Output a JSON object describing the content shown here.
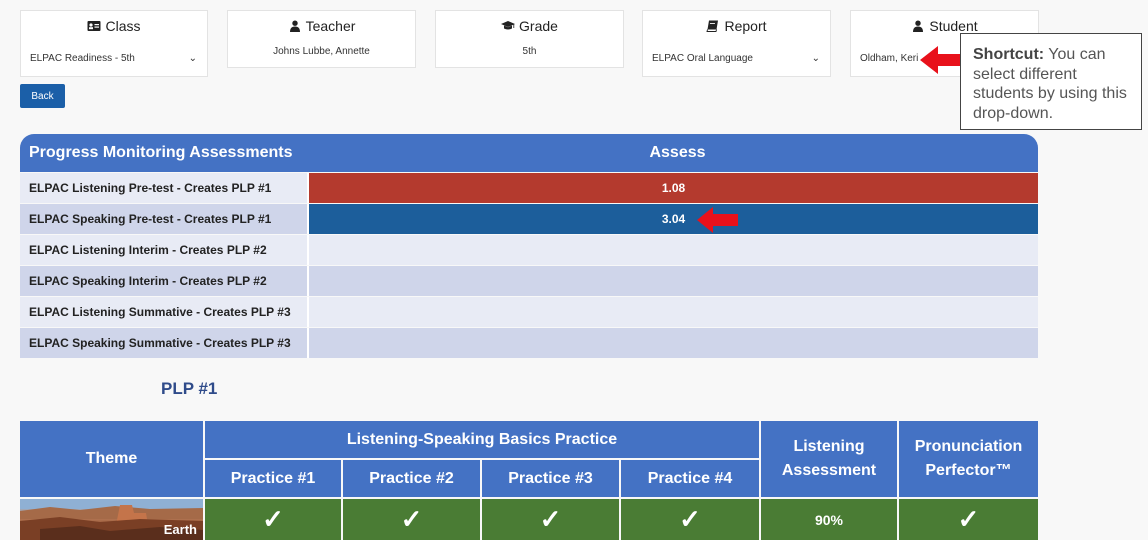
{
  "filters": {
    "class": {
      "label": "Class",
      "value": "ELPAC Readiness - 5th"
    },
    "teacher": {
      "label": "Teacher",
      "value": "Johns Lubbe, Annette"
    },
    "grade": {
      "label": "Grade",
      "value": "5th"
    },
    "report": {
      "label": "Report",
      "value": "ELPAC Oral Language"
    },
    "student": {
      "label": "Student",
      "value": "Oldham, Keri"
    }
  },
  "back_label": "Back",
  "callout": {
    "bold": "Shortcut:",
    "text": "You can select different students by using this drop-down."
  },
  "assessments": {
    "col_title": "Progress Monitoring Assessments",
    "col_assess": "Assess",
    "rows": [
      {
        "label": "ELPAC Listening Pre-test - Creates PLP #1",
        "value": "1.08",
        "color": "#b43a2e"
      },
      {
        "label": "ELPAC Speaking Pre-test - Creates PLP #1",
        "value": "3.04",
        "color": "#1c5e9b"
      },
      {
        "label": "ELPAC Listening Interim - Creates PLP #2",
        "value": ""
      },
      {
        "label": "ELPAC Speaking Interim - Creates PLP #2",
        "value": ""
      },
      {
        "label": "ELPAC Listening Summative - Creates PLP #3",
        "value": ""
      },
      {
        "label": "ELPAC Speaking Summative - Creates PLP #3",
        "value": ""
      }
    ]
  },
  "plp": {
    "title": "PLP #1",
    "headers": {
      "theme": "Theme",
      "basics": "Listening-Speaking Basics Practice",
      "practice": [
        "Practice #1",
        "Practice #2",
        "Practice #3",
        "Practice #4"
      ],
      "listening_line1": "Listening",
      "listening_line2": "Assessment",
      "pron_line1": "Pronunciation",
      "pron_line2": "Perfector™"
    },
    "row": {
      "theme": "Earth",
      "practice": [
        "✓",
        "✓",
        "✓",
        "✓"
      ],
      "listening": "90%",
      "pronunciation": "✓"
    }
  },
  "colors": {
    "header_blue": "#4472c4",
    "done_green": "#4a7c34",
    "back_blue": "#1b5fa8",
    "arrow_red": "#e8111b"
  }
}
